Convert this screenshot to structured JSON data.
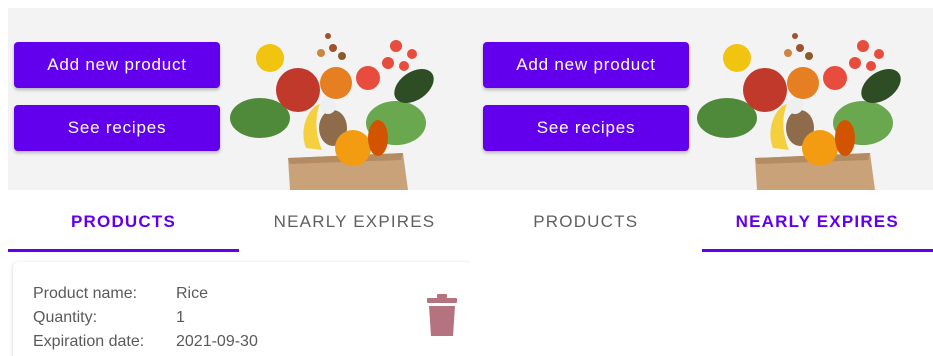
{
  "left_screen": {
    "buttons": {
      "add_product": "Add new product",
      "see_recipes": "See recipes"
    },
    "tabs": [
      {
        "label": "PRODUCTS",
        "active": true
      },
      {
        "label": "NEARLY EXPIRES",
        "active": false
      }
    ],
    "product_card": {
      "fields": [
        {
          "label": "Product name:",
          "value": "Rice"
        },
        {
          "label": "Quantity:",
          "value": "1"
        },
        {
          "label": "Expiration date:",
          "value": "2021-09-30"
        }
      ],
      "delete_icon": "trash-icon"
    }
  },
  "right_screen": {
    "buttons": {
      "add_product": "Add new product",
      "see_recipes": "See recipes"
    },
    "tabs": [
      {
        "label": "PRODUCTS",
        "active": false
      },
      {
        "label": "NEARLY EXPIRES",
        "active": true
      }
    ]
  },
  "colors": {
    "primary": "#6200ee",
    "tab_inactive": "#5f5f5f",
    "trash": "#b5727f",
    "hero_background": "#f3f3f3"
  }
}
